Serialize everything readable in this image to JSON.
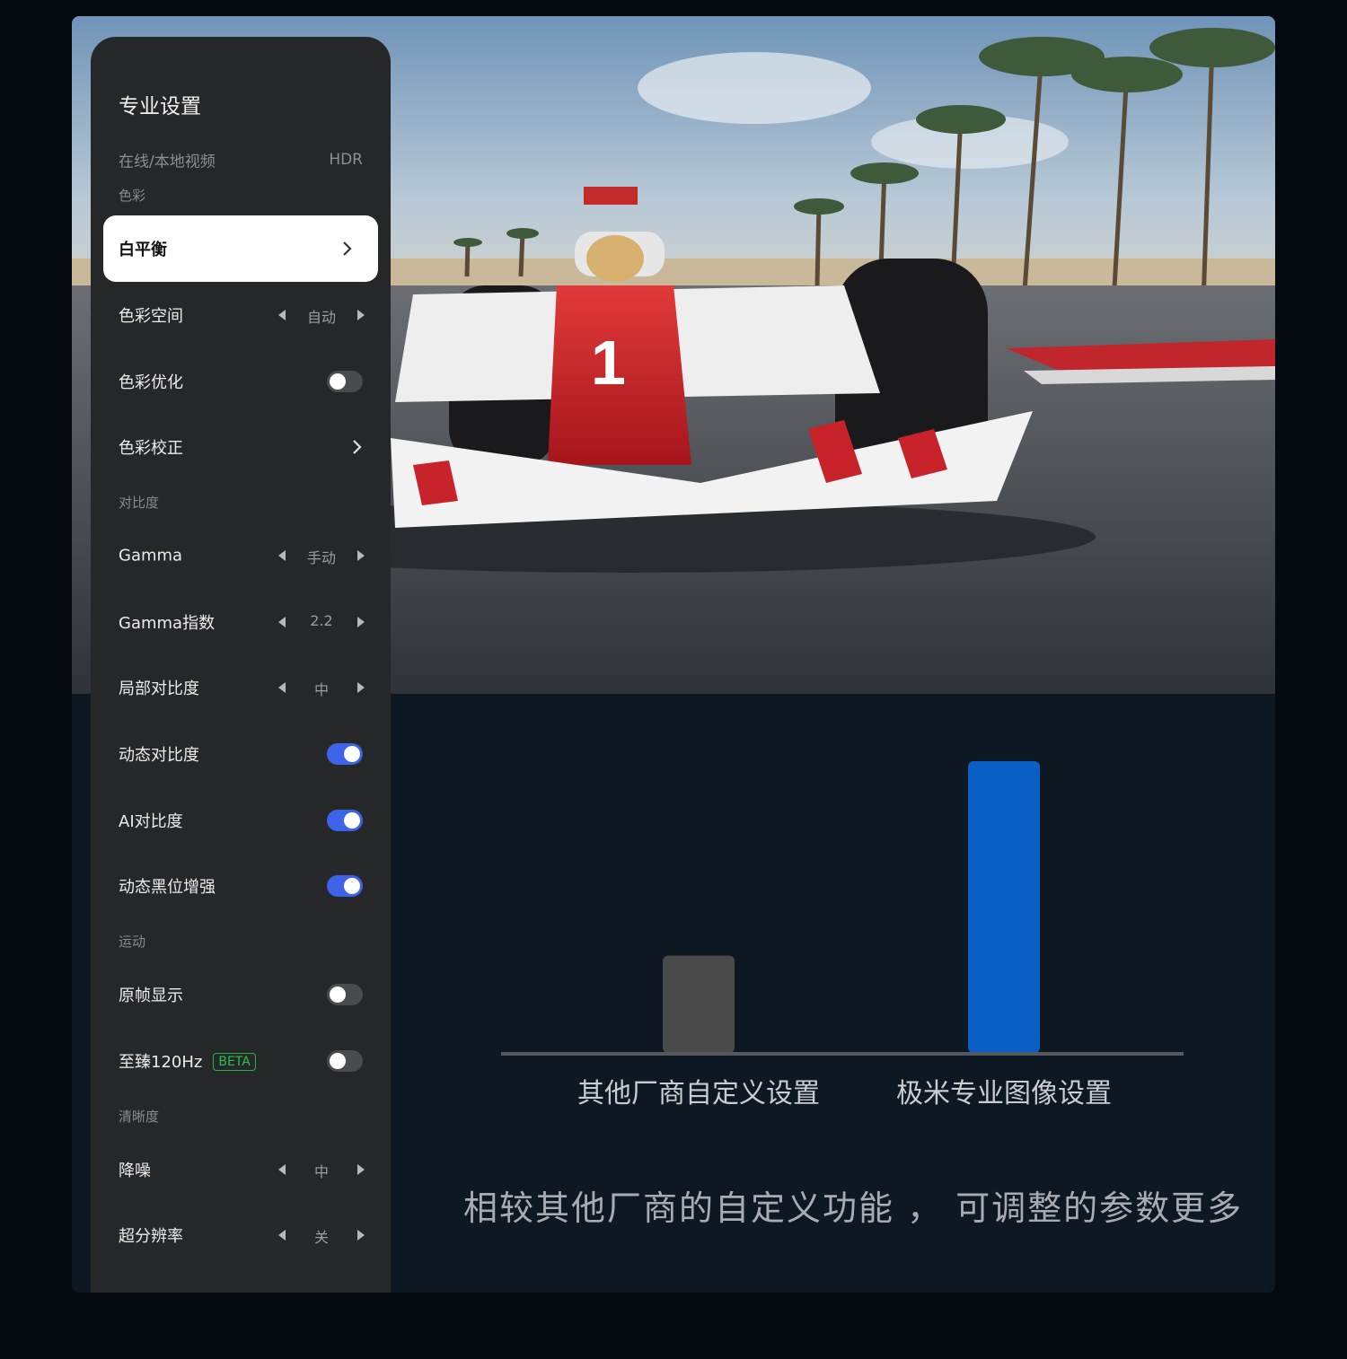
{
  "panel": {
    "title": "专业设置",
    "mode_row": {
      "label": "在线/本地视频",
      "value": "HDR"
    },
    "sections": [
      {
        "title": "色彩"
      },
      {
        "title": "对比度"
      },
      {
        "title": "运动"
      },
      {
        "title": "清晰度"
      }
    ],
    "items": [
      {
        "label": "白平衡",
        "control": "chevron",
        "selected": true
      },
      {
        "label": "色彩空间",
        "control": "stepper",
        "value": "自动"
      },
      {
        "label": "色彩优化",
        "control": "toggle",
        "on": false
      },
      {
        "label": "色彩校正",
        "control": "chevron"
      },
      {
        "label": "Gamma",
        "control": "stepper",
        "value": "手动"
      },
      {
        "label": "Gamma指数",
        "control": "stepper",
        "value": "2.2"
      },
      {
        "label": "局部对比度",
        "control": "stepper",
        "value": "中"
      },
      {
        "label": "动态对比度",
        "control": "toggle",
        "on": true
      },
      {
        "label": "AI对比度",
        "control": "toggle",
        "on": true
      },
      {
        "label": "动态黑位增强",
        "control": "toggle",
        "on": true
      },
      {
        "label": "原帧显示",
        "control": "toggle",
        "on": false
      },
      {
        "label": "至臻120Hz",
        "badge": "BETA",
        "control": "toggle",
        "on": false
      },
      {
        "label": "降噪",
        "control": "stepper",
        "value": "中"
      },
      {
        "label": "超分辨率",
        "control": "stepper",
        "value": "关"
      }
    ]
  },
  "chart_data": {
    "type": "bar",
    "categories": [
      "其他厂商自定义设置",
      "极米专业图像设置"
    ],
    "values": [
      1,
      3
    ],
    "colors": [
      "#4a4a4a",
      "#0a5fc4"
    ],
    "ylim": [
      0,
      3
    ],
    "grid": false,
    "title": "",
    "xlabel": "",
    "ylabel": ""
  },
  "caption": "相较其他厂商的自定义功能 ， 可调整的参数更多",
  "colors": {
    "panel_bg": "#262729",
    "toggle_on": "#3d63e8",
    "beta_green": "#25c14f",
    "page_bg": "#0d1822"
  }
}
